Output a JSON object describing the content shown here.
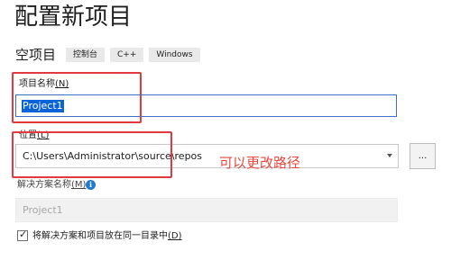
{
  "header": {
    "title": "配置新项目",
    "template_name": "空项目",
    "tags": [
      "控制台",
      "C++",
      "Windows"
    ]
  },
  "project_name": {
    "label": "项目名称",
    "label_key": "(N)",
    "value": "Project1"
  },
  "location": {
    "label": "位置",
    "label_key": "(L)",
    "value": "C:\\Users\\Administrator\\source\\repos",
    "browse_label": "..."
  },
  "annotation": {
    "text": "可以更改路径",
    "color": "#e8473d"
  },
  "solution_name": {
    "label": "解决方案名称",
    "label_key": "(M)",
    "value": "Project1",
    "icon": "info-icon"
  },
  "options": {
    "same_directory_label": "将解决方案和项目放在同一目录中",
    "same_directory_key": "(D)",
    "same_directory_checked": true
  },
  "colors": {
    "accent": "#0a64d7",
    "highlight_box": "#e0393e"
  }
}
